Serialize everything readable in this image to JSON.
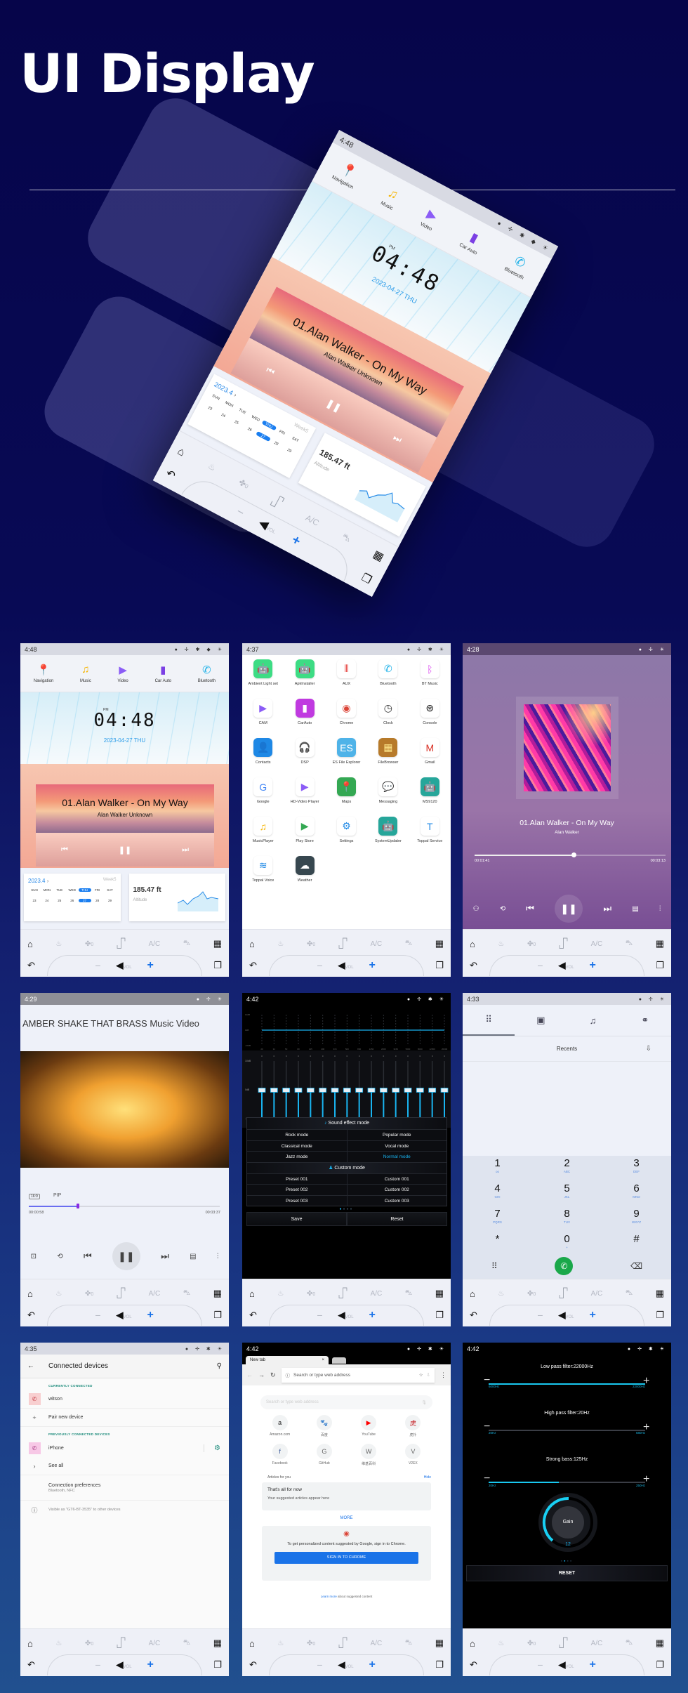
{
  "page": {
    "title": "UI Display"
  },
  "navbar": {
    "ac": "A/C",
    "vol": "VOL",
    "fan": "0"
  },
  "home": {
    "time": "4:48",
    "apps": [
      "Navigation",
      "Music",
      "Video",
      "Car Auto",
      "Bluetooth"
    ],
    "clock": {
      "ampm": "PM",
      "time": "04:48",
      "date": "2023-04-27  THU"
    },
    "music": {
      "title": "01.Alan Walker - On My Way",
      "subtitle": "Alan Walker  Unknown"
    },
    "calendar": {
      "month": "2023.4",
      "week": "Week5",
      "days": [
        "SUN",
        "MON",
        "TUE",
        "WED",
        "THU",
        "FRI",
        "SAT"
      ],
      "dates": [
        "23",
        "24",
        "25",
        "26",
        "27",
        "28",
        "29"
      ],
      "selected": "27"
    },
    "altitude": {
      "value": "185.47 ft",
      "label": "Altitude"
    }
  },
  "apps_screen": {
    "time": "4:37",
    "apps": [
      {
        "label": "Ambient Light set",
        "icon": "android",
        "color": "#3ddc84"
      },
      {
        "label": "ApkInstaller",
        "icon": "android",
        "color": "#3ddc84"
      },
      {
        "label": "AUX",
        "icon": "aux",
        "color": "#ffffff"
      },
      {
        "label": "Bluetooth",
        "icon": "bluetooth",
        "color": "#ffffff"
      },
      {
        "label": "BT Music",
        "icon": "bt-music",
        "color": "#ffffff"
      },
      {
        "label": "CAM",
        "icon": "camera",
        "color": "#ffffff"
      },
      {
        "label": "CarAuto",
        "icon": "car-auto",
        "color": "#c03ae0"
      },
      {
        "label": "Chrome",
        "icon": "chrome",
        "color": "#ffffff"
      },
      {
        "label": "Clock",
        "icon": "clock",
        "color": "#ffffff"
      },
      {
        "label": "Console",
        "icon": "steering",
        "color": "#ffffff"
      },
      {
        "label": "Contacts",
        "icon": "contacts",
        "color": "#1e88e5"
      },
      {
        "label": "DSP",
        "icon": "headphones",
        "color": "#ffffff"
      },
      {
        "label": "ES File Explorer",
        "icon": "folder",
        "color": "#4fb3e8"
      },
      {
        "label": "FileBrowser",
        "icon": "box",
        "color": "#b77a2a"
      },
      {
        "label": "Gmail",
        "icon": "gmail",
        "color": "#ffffff"
      },
      {
        "label": "Google",
        "icon": "google",
        "color": "#ffffff"
      },
      {
        "label": "HD-Video Player",
        "icon": "video",
        "color": "#ffffff"
      },
      {
        "label": "Maps",
        "icon": "maps",
        "color": "#34a853"
      },
      {
        "label": "Messaging",
        "icon": "message",
        "color": "#ffffff"
      },
      {
        "label": "MS9120",
        "icon": "android",
        "color": "#26a69a"
      },
      {
        "label": "MusicPlayer",
        "icon": "music",
        "color": "#ffffff"
      },
      {
        "label": "Play Store",
        "icon": "play",
        "color": "#ffffff"
      },
      {
        "label": "Settings",
        "icon": "gear",
        "color": "#ffffff"
      },
      {
        "label": "SystemUpdater",
        "icon": "android",
        "color": "#26a69a"
      },
      {
        "label": "Toppal Service",
        "icon": "toppal",
        "color": "#ffffff"
      },
      {
        "label": "Toppal Voice",
        "icon": "voice",
        "color": "#ffffff"
      },
      {
        "label": "Weather",
        "icon": "weather",
        "color": "#37474f"
      }
    ]
  },
  "music_player": {
    "time": "4:28",
    "title": "01.Alan Walker - On My Way",
    "artist": "Alan Walker",
    "elapsed": "00:01:41",
    "total": "00:03:13",
    "progress": 0.52
  },
  "video_player": {
    "time": "4:29",
    "title": "AMBER SHAKE THAT BRASS Music Video",
    "aspect": "16:9",
    "pip": "PIP",
    "elapsed": "00:00:58",
    "total": "00:03:37",
    "progress": 0.26
  },
  "equalizer": {
    "time": "4:42",
    "bands": [
      "20",
      "31",
      "50",
      "80",
      "125",
      "200",
      "315",
      "500",
      "800",
      "1250",
      "2000",
      "3150",
      "5000",
      "8000",
      "12500",
      "20000"
    ],
    "values": [
      0,
      0,
      0,
      0,
      0,
      0,
      0,
      0,
      0,
      0,
      0,
      0,
      0,
      0,
      0,
      0
    ],
    "range_db": [
      -10,
      10
    ],
    "scale": [
      "10dB",
      "0dB",
      "-10dB"
    ],
    "sound_mode_title": "Sound effect mode",
    "modes": [
      [
        "Rock mode",
        "Popular mode"
      ],
      [
        "Classical mode",
        "Vocal mode"
      ],
      [
        "Jazz mode",
        "Normal mode"
      ]
    ],
    "active_mode": "Normal mode",
    "custom_title": "Custom mode",
    "presets": [
      [
        "Preset 001",
        "Custom 001"
      ],
      [
        "Preset 002",
        "Custom 002"
      ],
      [
        "Preset 003",
        "Custom 003"
      ]
    ],
    "save": "Save",
    "reset": "Reset",
    "accent": "#19b4f0"
  },
  "phone": {
    "time": "4:33",
    "recents": "Recents",
    "keys": [
      {
        "d": "1",
        "l": "oo"
      },
      {
        "d": "2",
        "l": "ABC"
      },
      {
        "d": "3",
        "l": "DEF"
      },
      {
        "d": "4",
        "l": "GHI"
      },
      {
        "d": "5",
        "l": "JKL"
      },
      {
        "d": "6",
        "l": "MNO"
      },
      {
        "d": "7",
        "l": "PQRS"
      },
      {
        "d": "8",
        "l": "TUV"
      },
      {
        "d": "9",
        "l": "WXYZ"
      },
      {
        "d": "*",
        "l": ""
      },
      {
        "d": "0",
        "l": "+"
      },
      {
        "d": "#",
        "l": ""
      }
    ],
    "call_color": "#1aa84a"
  },
  "bluetooth": {
    "time": "4:35",
    "title": "Connected devices",
    "currently": "CURRENTLY CONNECTED",
    "device": "witson",
    "pair": "Pair new device",
    "previously": "PREVIOUSLY CONNECTED DEVICES",
    "prev_device": "iPhone",
    "see_all": "See all",
    "prefs": "Connection preferences",
    "prefs_sub": "Bluetooth, NFC",
    "visible": "Visible as \"GT6-BT-3535\" to other devices"
  },
  "chrome": {
    "time": "4:42",
    "tab": "New tab",
    "omnibox": "Search or type web address",
    "search": "Search or type web address",
    "shortcuts": [
      {
        "label": "Amazon.com",
        "g": "a"
      },
      {
        "label": "百度",
        "g": "🐾"
      },
      {
        "label": "YouTube",
        "g": "▶"
      },
      {
        "label": "虎扑",
        "g": "虎"
      },
      {
        "label": "Facebook",
        "g": "f"
      },
      {
        "label": "GitHub",
        "g": "G"
      },
      {
        "label": "维基百科",
        "g": "W"
      },
      {
        "label": "V2EX",
        "g": "V"
      }
    ],
    "articles": "Articles for you",
    "hide": "Hide",
    "empty_title": "That's all for now",
    "empty_sub": "Your suggested articles appear here",
    "more": "MORE",
    "signin_text": "To get personalized content suggested by Google, sign in to Chrome.",
    "signin_button": "SIGN IN TO CHROME",
    "learn_more": "Learn more",
    "learn_more_rest": "about suggested content"
  },
  "audio": {
    "time": "4:42",
    "filters": [
      {
        "label": "Low pass filter:22000Hz",
        "min": "6000Hz",
        "max": "22000Hz",
        "level": 1.0
      },
      {
        "label": "High pass filter:20Hz",
        "min": "20Hz",
        "max": "680Hz",
        "level": 0.0
      },
      {
        "label": "Strong bass:125Hz",
        "min": "20Hz",
        "max": "250Hz",
        "level": 0.45
      }
    ],
    "gain_label": "Gain",
    "gain": "12",
    "reset": "RESET"
  }
}
